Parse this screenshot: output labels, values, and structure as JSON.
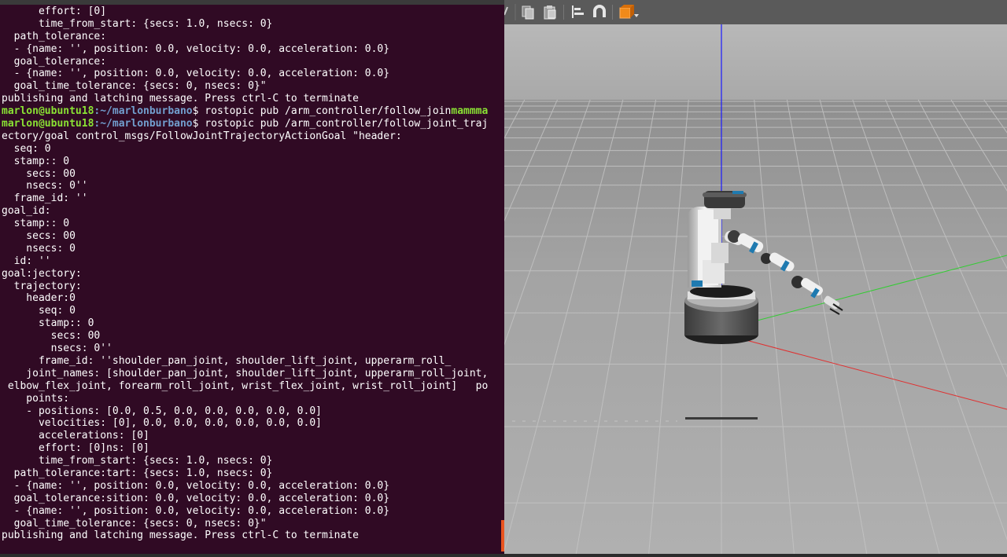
{
  "terminal": {
    "lines": [
      {
        "text": "      effort: [0]"
      },
      {
        "text": "      time_from_start: {secs: 1.0, nsecs: 0}"
      },
      {
        "text": "  path_tolerance:"
      },
      {
        "text": "  - {name: '', position: 0.0, velocity: 0.0, acceleration: 0.0}"
      },
      {
        "text": "  goal_tolerance:"
      },
      {
        "text": "  - {name: '', position: 0.0, velocity: 0.0, acceleration: 0.0}"
      },
      {
        "text": "  goal_time_tolerance: {secs: 0, nsecs: 0}\""
      },
      {
        "text": "publishing and latching message. Press ctrl-C to terminate"
      },
      {
        "user": "marlon@ubuntu18",
        "path": ":~/marlonburbano",
        "cmd": "$ rostopic pub /arm_controller/follow_join",
        "tail": "mammma"
      },
      {
        "user": "marlon@ubuntu18",
        "path": ":~/marlonburbano",
        "cmd": "$ rostopic pub /arm_controller/follow_joint_traj"
      },
      {
        "text": "ectory/goal control_msgs/FollowJointTrajectoryActionGoal \"header:"
      },
      {
        "text": "  seq: 0"
      },
      {
        "text": "  stamp:: 0"
      },
      {
        "text": "    secs: 00"
      },
      {
        "text": "    nsecs: 0''"
      },
      {
        "text": "  frame_id: ''"
      },
      {
        "text": "goal_id:"
      },
      {
        "text": "  stamp:: 0"
      },
      {
        "text": "    secs: 00"
      },
      {
        "text": "    nsecs: 0"
      },
      {
        "text": "  id: ''"
      },
      {
        "text": "goal:jectory:"
      },
      {
        "text": "  trajectory:"
      },
      {
        "text": "    header:0"
      },
      {
        "text": "      seq: 0"
      },
      {
        "text": "      stamp:: 0"
      },
      {
        "text": "        secs: 00"
      },
      {
        "text": "        nsecs: 0''"
      },
      {
        "text": "      frame_id: ''shoulder_pan_joint, shoulder_lift_joint, upperarm_roll_"
      },
      {
        "text": "    joint_names: [shoulder_pan_joint, shoulder_lift_joint, upperarm_roll_joint,"
      },
      {
        "text": " elbow_flex_joint, forearm_roll_joint, wrist_flex_joint, wrist_roll_joint]   po"
      },
      {
        "text": "    points:"
      },
      {
        "text": "    - positions: [0.0, 0.5, 0.0, 0.0, 0.0, 0.0, 0.0]"
      },
      {
        "text": "      velocities: [0], 0.0, 0.0, 0.0, 0.0, 0.0, 0.0]"
      },
      {
        "text": "      accelerations: [0]"
      },
      {
        "text": "      effort: [0]ns: [0]"
      },
      {
        "text": "      time_from_start: {secs: 1.0, nsecs: 0}"
      },
      {
        "text": "  path_tolerance:tart: {secs: 1.0, nsecs: 0}"
      },
      {
        "text": "  - {name: '', position: 0.0, velocity: 0.0, acceleration: 0.0}"
      },
      {
        "text": "  goal_tolerance:sition: 0.0, velocity: 0.0, acceleration: 0.0}"
      },
      {
        "text": "  - {name: '', position: 0.0, velocity: 0.0, acceleration: 0.0}"
      },
      {
        "text": "  goal_time_tolerance: {secs: 0, nsecs: 0}\""
      },
      {
        "text": "publishing and latching message. Press ctrl-C to terminate"
      }
    ]
  },
  "gazebo": {
    "toolbar_icons": [
      "copy-icon",
      "paste-icon",
      "align-icon",
      "magnet-icon",
      "view-angle-icon"
    ],
    "colors": {
      "toolbar": "#5a5a5a",
      "sky": "#b2b2b2",
      "ground": "#a9a9a9",
      "z_axis": "#1a1aff",
      "y_axis": "#33cc33",
      "x_axis": "#e03030",
      "robot_accent": "#1f7ab0"
    }
  }
}
